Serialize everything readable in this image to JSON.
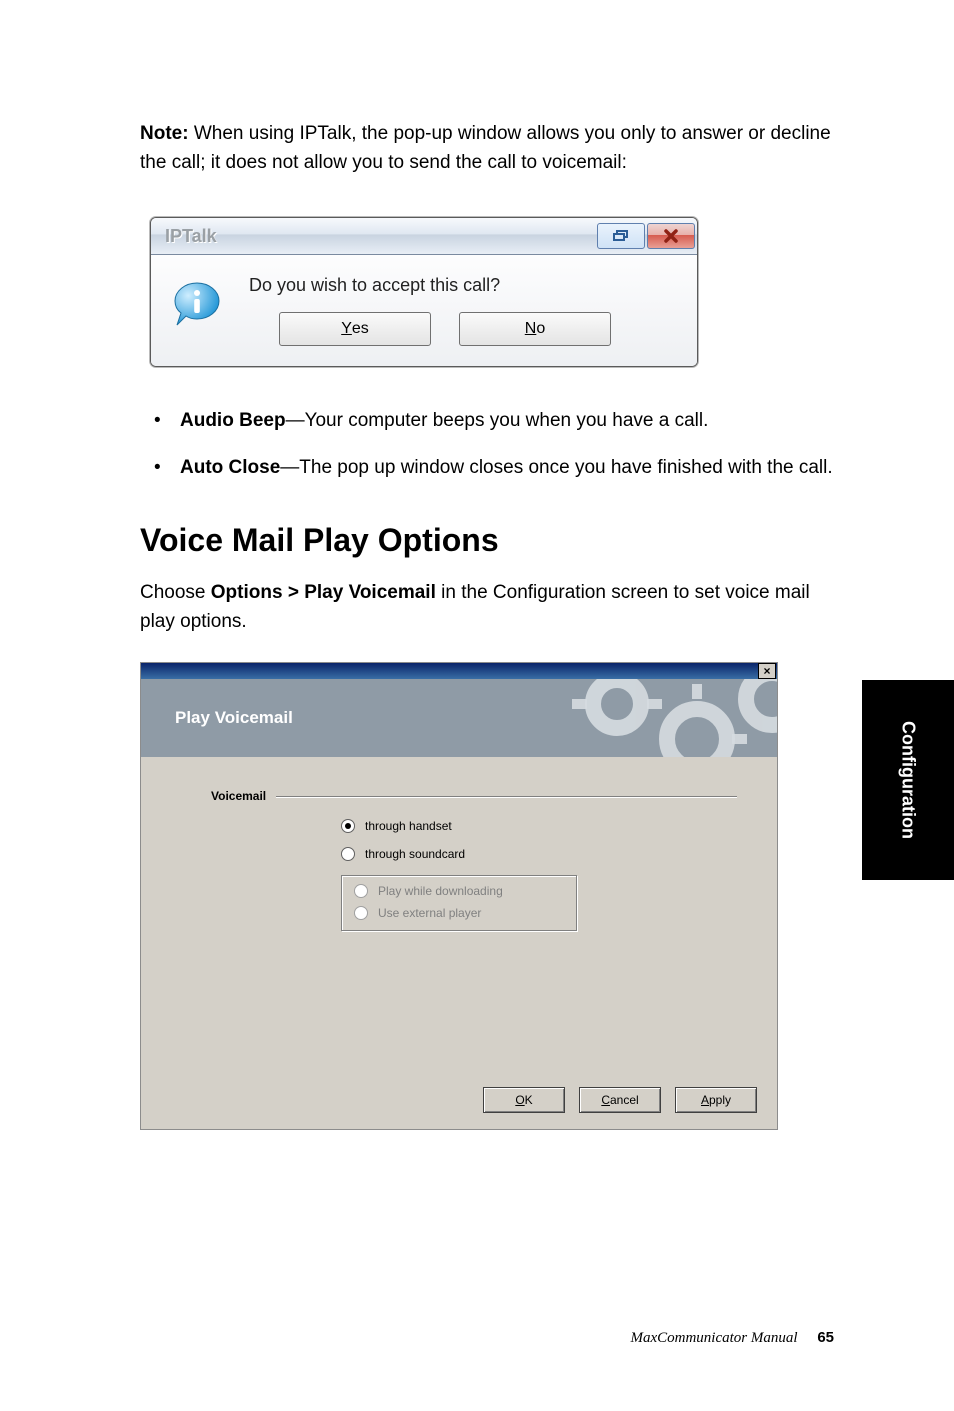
{
  "note": {
    "label": "Note:",
    "text": " When using IPTalk, the pop-up window allows you only to answer or decline the call; it does not allow you to send the call to voicemail:"
  },
  "iptalk": {
    "title": "IPTalk",
    "message": "Do you wish to accept this call?",
    "yes_label": "Yes",
    "yes_first": "Y",
    "yes_rest": "es",
    "no_label": "No",
    "no_first": "N",
    "no_rest": "o"
  },
  "bullets": [
    {
      "term": "Audio Beep",
      "desc": "—Your computer beeps you when you have a call."
    },
    {
      "term": "Auto Close",
      "desc": "—The pop up window closes once you have finished with the call."
    }
  ],
  "heading": "Voice Mail Play Options",
  "para": {
    "prefix": "Choose ",
    "strong": "Options > Play Voicemail",
    "suffix": " in the Configuration screen to set voice mail play options."
  },
  "pv": {
    "close_x": "×",
    "header": "Play Voicemail",
    "group_label": "Voicemail",
    "opt_handset": "through handset",
    "opt_soundcard": "through soundcard",
    "opt_download": "Play while downloading",
    "opt_external": "Use external player",
    "ok_first": "O",
    "ok_rest": "K",
    "cancel_first": "C",
    "cancel_rest": "ancel",
    "apply_first": "A",
    "apply_rest": "pply"
  },
  "sidetab": "Configuration",
  "footer": {
    "manual": "MaxCommunicator Manual",
    "page": "65"
  }
}
